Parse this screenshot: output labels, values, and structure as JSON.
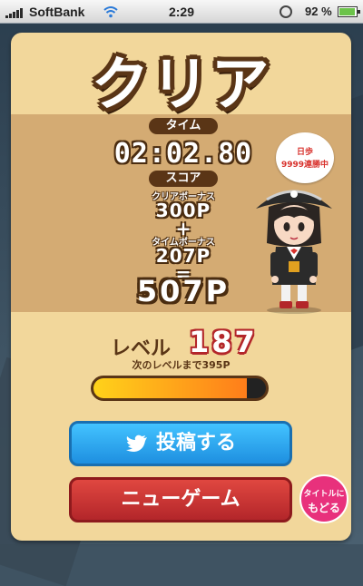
{
  "status_bar": {
    "carrier": "SoftBank",
    "time": "2:29",
    "battery_percent": "92 %"
  },
  "result": {
    "title": "クリア",
    "time_label": "タイム",
    "time_value": "02:02.80",
    "score_label": "スコア",
    "clear_bonus_label": "クリアボーナス",
    "clear_bonus_value": "300P",
    "plus": "+",
    "time_bonus_label": "タイムボーナス",
    "time_bonus_value": "207P",
    "equals": "=",
    "total": "507P"
  },
  "speech_bubble": {
    "line1": "日歩",
    "line2": "9999連勝中"
  },
  "level": {
    "label": "レベル",
    "value": "187",
    "next_text": "次のレベルまで395P",
    "progress_fraction": 0.89
  },
  "buttons": {
    "tweet": "投稿する",
    "new_game": "ニューゲーム",
    "title_line1": "タイトルに",
    "title_line2": "もどる"
  },
  "colors": {
    "card": "#f2d79b",
    "panel": "#d4ab73",
    "brown": "#5a3516",
    "tweet_blue": "#1e8fe0",
    "new_game_red": "#b3262a",
    "title_pink": "#e8317c",
    "level_red": "#b3262a"
  }
}
